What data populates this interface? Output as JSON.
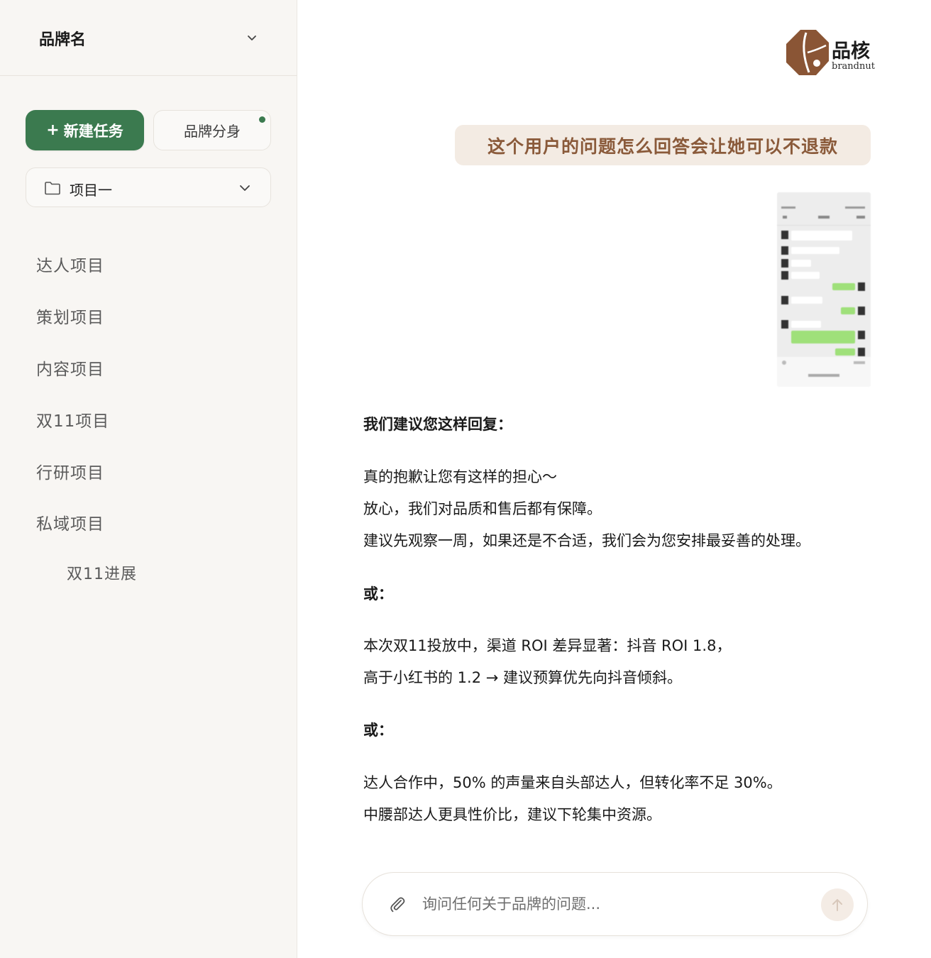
{
  "sidebar": {
    "brand_name": "品牌名",
    "new_task_plus": "+",
    "new_task_label": "新建任务",
    "brand_avatar_label": "品牌分身",
    "project_selector": "项目一",
    "items": [
      {
        "label": "达人项目"
      },
      {
        "label": "策划项目"
      },
      {
        "label": "内容项目"
      },
      {
        "label": "双11项目"
      },
      {
        "label": "行研项目"
      },
      {
        "label": "私域项目"
      }
    ],
    "sub_items": [
      {
        "label": "双11进展"
      }
    ]
  },
  "logo": {
    "cn": "品核",
    "en": "brandnut"
  },
  "chat": {
    "user_message": "这个用户的问题怎么回答会让她可以不退款",
    "answer": {
      "intro": "我们建议您这样回复：",
      "option1": [
        "真的抱歉让您有这样的担心～",
        "放心，我们对品质和售后都有保障。",
        "建议先观察一周，如果还是不合适，我们会为您安排最妥善的处理。"
      ],
      "or_label_1": "或：",
      "option2": [
        "本次双11投放中，渠道 ROI 差异显著：抖音 ROI 1.8，",
        "高于小红书的 1.2 → 建议预算优先向抖音倾斜。"
      ],
      "or_label_2": "或：",
      "option3": [
        "达人合作中，50% 的声量来自头部达人，但转化率不足 30%。",
        "中腰部达人更具性价比，建议下轮集中资源。"
      ]
    }
  },
  "input": {
    "placeholder": "询问任何关于品牌的问题..."
  },
  "colors": {
    "accent_green": "#3b7a4f",
    "brand_brown": "#8a5a3a",
    "bubble_bg": "#f3ebe3",
    "sidebar_bg": "#f8f6f3"
  },
  "icons": [
    "chevron-down-icon",
    "folder-icon",
    "paperclip-icon",
    "arrow-up-icon",
    "brand-logo-icon"
  ]
}
